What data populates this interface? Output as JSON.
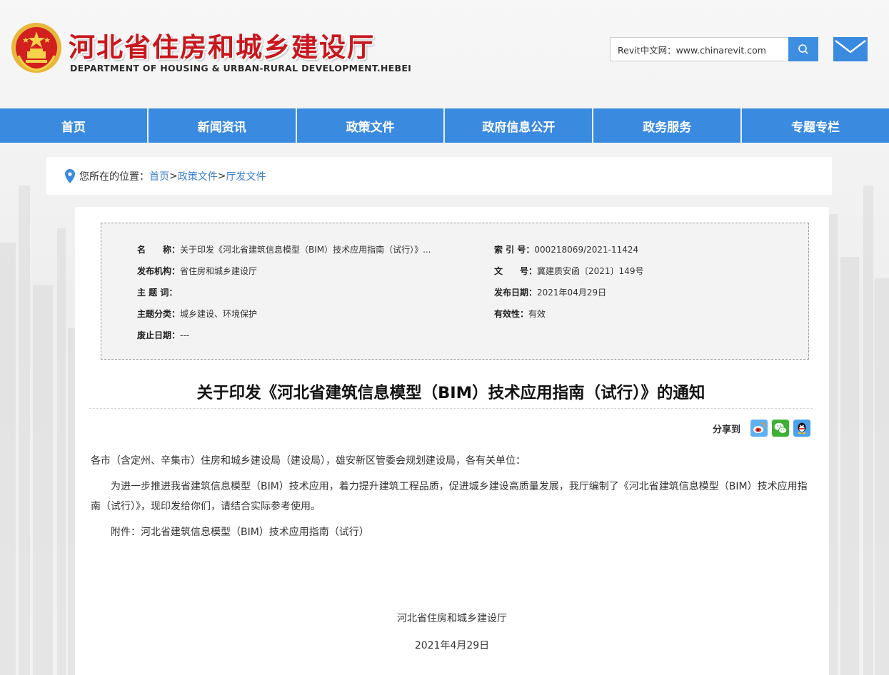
{
  "header": {
    "title": "河北省住房和城乡建设厅",
    "subtitle": "DEPARTMENT OF HOUSING & URBAN-RURAL DEVELOPMENT.HEBEI",
    "search": {
      "value": "Revit中文网：www.chinarevit.com",
      "placeholder": ""
    }
  },
  "nav": {
    "items": [
      {
        "label": "首页"
      },
      {
        "label": "新闻资讯"
      },
      {
        "label": "政策文件"
      },
      {
        "label": "政府信息公开"
      },
      {
        "label": "政务服务"
      },
      {
        "label": "专题专栏"
      }
    ]
  },
  "breadcrumb": {
    "prefix": "您所在的位置：",
    "items": [
      "首页",
      "政策文件",
      "厅发文件"
    ],
    "separator": ">"
  },
  "meta": {
    "name_label": "名　　称：",
    "name_value": "关于印发《河北省建筑信息模型（BIM）技术应用指南（试行）》...",
    "issuer_label": "发布机构：",
    "issuer_value": "省住房和城乡建设厅",
    "keywords_label": "主 题 词：",
    "keywords_value": "",
    "category_label": "主题分类：",
    "category_value": "城乡建设、环境保护",
    "abolish_label": "废止日期：",
    "abolish_value": "---",
    "index_label": "索 引 号：",
    "index_value": "000218069/2021-11424",
    "docno_label": "文　　号：",
    "docno_value": "冀建质安函〔2021〕149号",
    "date_label": "发布日期：",
    "date_value": "2021年04月29日",
    "validity_label": "有效性：",
    "validity_value": "有效"
  },
  "article": {
    "title": "关于印发《河北省建筑信息模型（BIM）技术应用指南（试行）》的通知",
    "share_label": "分享到",
    "salutation": "各市（含定州、辛集市）住房和城乡建设局（建设局），雄安新区管委会规划建设局，各有关单位：",
    "paragraph": "为进一步推进我省建筑信息模型（BIM）技术应用，着力提升建筑工程品质，促进城乡建设高质量发展，我厅编制了《河北省建筑信息模型（BIM）技术应用指南（试行）》，现印发给你们，请结合实际参考使用。",
    "attachment": "附件：河北省建筑信息模型（BIM）技术应用指南（试行）",
    "sign_org": "河北省住房和城乡建设厅",
    "sign_date": "2021年4月29日"
  },
  "colors": {
    "nav": "#3a8ae0",
    "title_red": "#c8171d",
    "link": "#3a7fcf"
  },
  "icons": [
    "emblem-icon",
    "search-icon",
    "mail-icon",
    "location-pin-icon",
    "weibo-icon",
    "wechat-icon",
    "qq-icon"
  ]
}
